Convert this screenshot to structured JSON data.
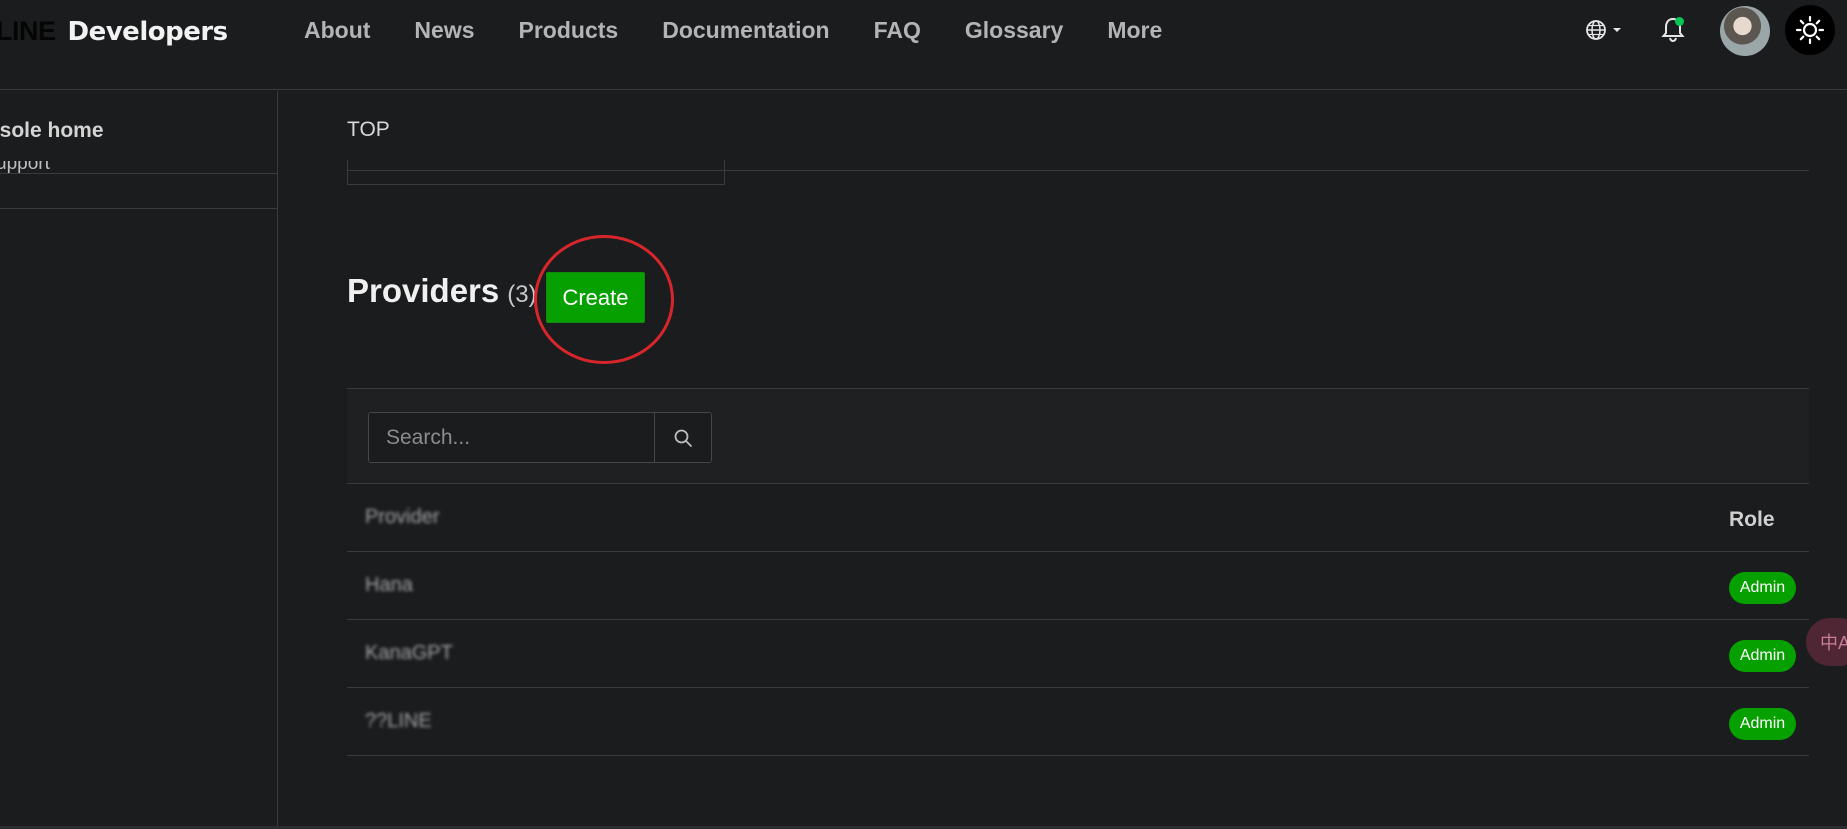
{
  "header": {
    "logo_line": "LINE",
    "logo_brand": "Developers",
    "nav": [
      "About",
      "News",
      "Products",
      "Documentation",
      "FAQ",
      "Glossary",
      "More"
    ],
    "icons": {
      "language": "globe-icon",
      "notifications": "bell-icon",
      "theme": "sun-icon"
    },
    "notification_dot_color": "#06c755"
  },
  "sidebar": {
    "home": "onsole home",
    "support": "upport"
  },
  "main": {
    "breadcrumb": "TOP",
    "title": "Providers",
    "count": "(3)",
    "create_label": "Create",
    "accent_color": "#06a000",
    "highlight_color": "#d7262b",
    "search_placeholder": "Search...",
    "table": {
      "header_name": "Provider",
      "header_role": "Role",
      "rows": [
        {
          "name": "Hana",
          "role": "Admin"
        },
        {
          "name": "KanaGPT",
          "role": "Admin"
        },
        {
          "name": "??LINE",
          "role": "Admin"
        }
      ]
    }
  },
  "translate_tab": "中A"
}
